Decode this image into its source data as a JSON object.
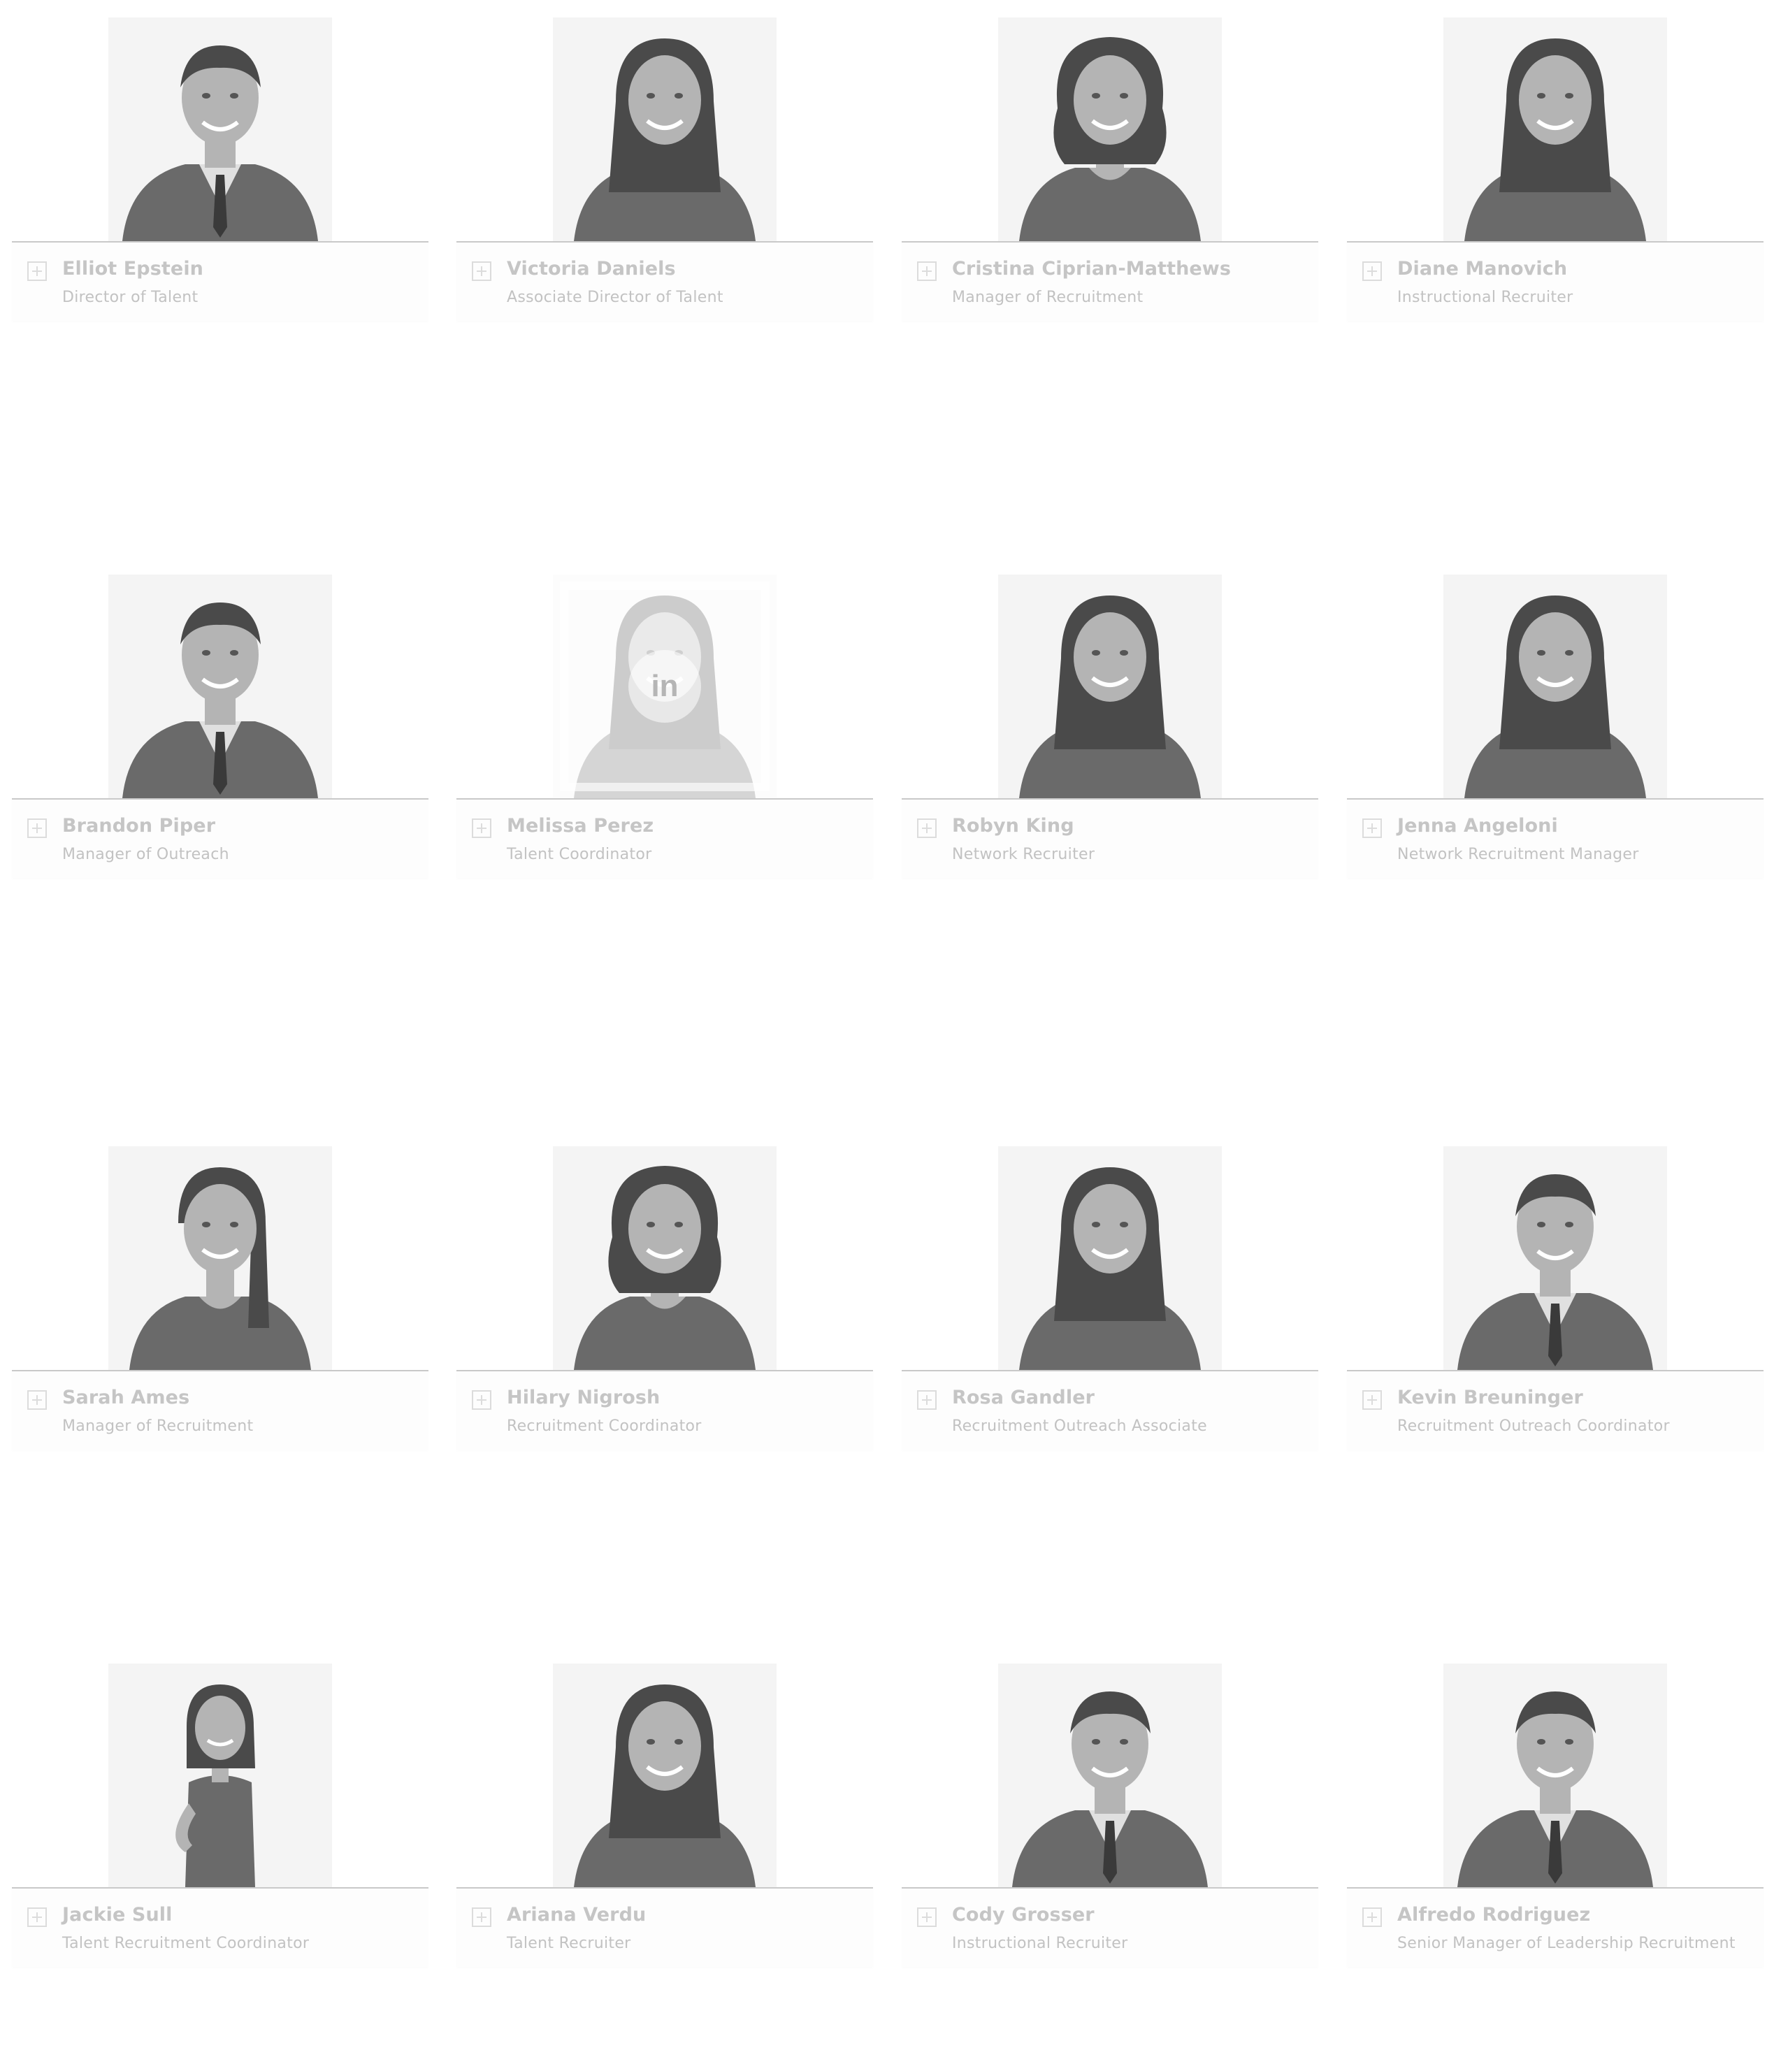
{
  "team": [
    {
      "name": "Elliot Epstein",
      "title": "Director of Talent",
      "avatar": "man-suit"
    },
    {
      "name": "Victoria Daniels",
      "title": "Associate Director of Talent",
      "avatar": "woman-long-hair"
    },
    {
      "name": "Cristina Ciprian-Matthews",
      "title": "Manager of Recruitment",
      "avatar": "woman-curly-hair"
    },
    {
      "name": "Diane Manovich",
      "title": "Instructional Recruiter",
      "avatar": "woman-long-hair"
    },
    {
      "name": "Brandon Piper",
      "title": "Manager of Outreach",
      "avatar": "man-suit"
    },
    {
      "name": "Melissa Perez",
      "title": "Talent Coordinator",
      "avatar": "woman-hover-linkedin",
      "linkedin_label": "in"
    },
    {
      "name": "Robyn King",
      "title": "Network Recruiter",
      "avatar": "woman-long-hair"
    },
    {
      "name": "Jenna Angeloni",
      "title": "Network Recruitment Manager",
      "avatar": "woman-long-hair"
    },
    {
      "name": "Sarah Ames",
      "title": "Manager of Recruitment",
      "avatar": "woman-ponytail"
    },
    {
      "name": "Hilary Nigrosh",
      "title": "Recruitment Coordinator",
      "avatar": "woman-wavy-hair"
    },
    {
      "name": "Rosa Gandler",
      "title": "Recruitment Outreach Associate",
      "avatar": "woman-long-hair"
    },
    {
      "name": "Kevin Breuninger",
      "title": "Recruitment Outreach Coordinator",
      "avatar": "man-suit"
    },
    {
      "name": "Jackie Sull",
      "title": "Talent Recruitment Coordinator",
      "avatar": "woman-standing"
    },
    {
      "name": "Ariana Verdu",
      "title": "Talent Recruiter",
      "avatar": "woman-long-hair"
    },
    {
      "name": "Cody Grosser",
      "title": "Instructional Recruiter",
      "avatar": "man-suit"
    },
    {
      "name": "Alfredo Rodriguez",
      "title": "Senior Manager of Leadership Recruitment",
      "avatar": "man-suit"
    }
  ],
  "colors": {
    "name_text": "#c5c5c5",
    "title_text": "#c2c2c2",
    "divider": "#c9c9c9",
    "photo_tone": "#808080"
  }
}
